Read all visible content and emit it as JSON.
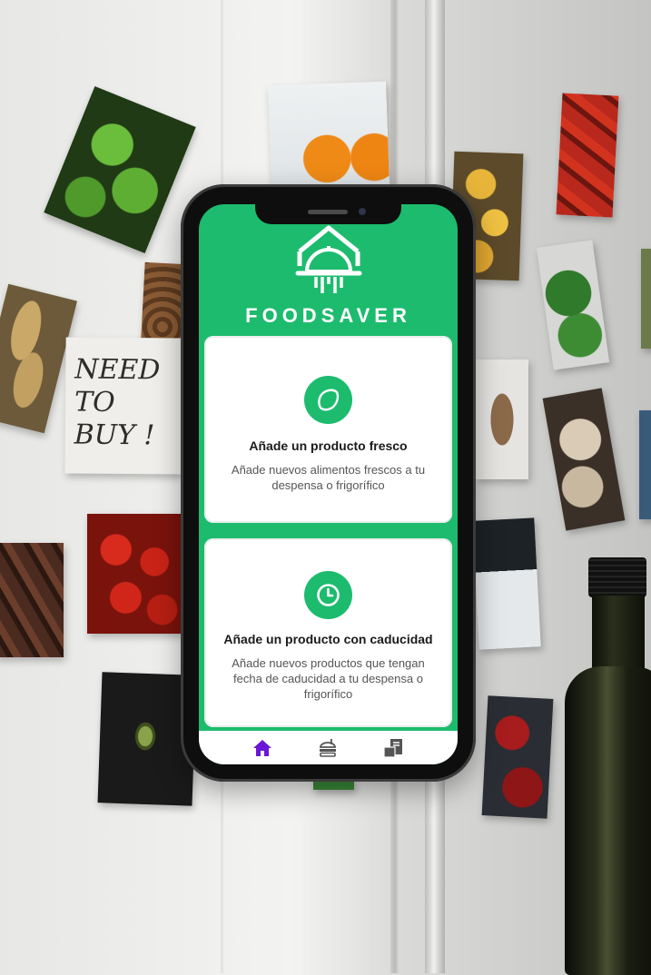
{
  "app": {
    "brand": "FOODSAVER",
    "accent_color": "#1dbb6e",
    "logo_icon": "house-cloche-icon"
  },
  "background": {
    "note_text": [
      "NEED",
      "TO",
      "BUY !"
    ]
  },
  "cards": [
    {
      "icon": "lemon-icon",
      "title": "Añade un producto fresco",
      "description": "Añade nuevos alimentos frescos a tu despensa o frigorífico"
    },
    {
      "icon": "clock-icon",
      "title": "Añade un producto con caducidad",
      "description": "Añade nuevos productos que tengan fecha de caducidad a tu despensa o frigorífico"
    }
  ],
  "nav": {
    "active_color": "#6a16d6",
    "inactive_color": "#555555",
    "items": [
      {
        "icon": "home-icon",
        "active": true
      },
      {
        "icon": "food-icon",
        "active": false
      },
      {
        "icon": "pantry-list-icon",
        "active": false
      }
    ]
  }
}
